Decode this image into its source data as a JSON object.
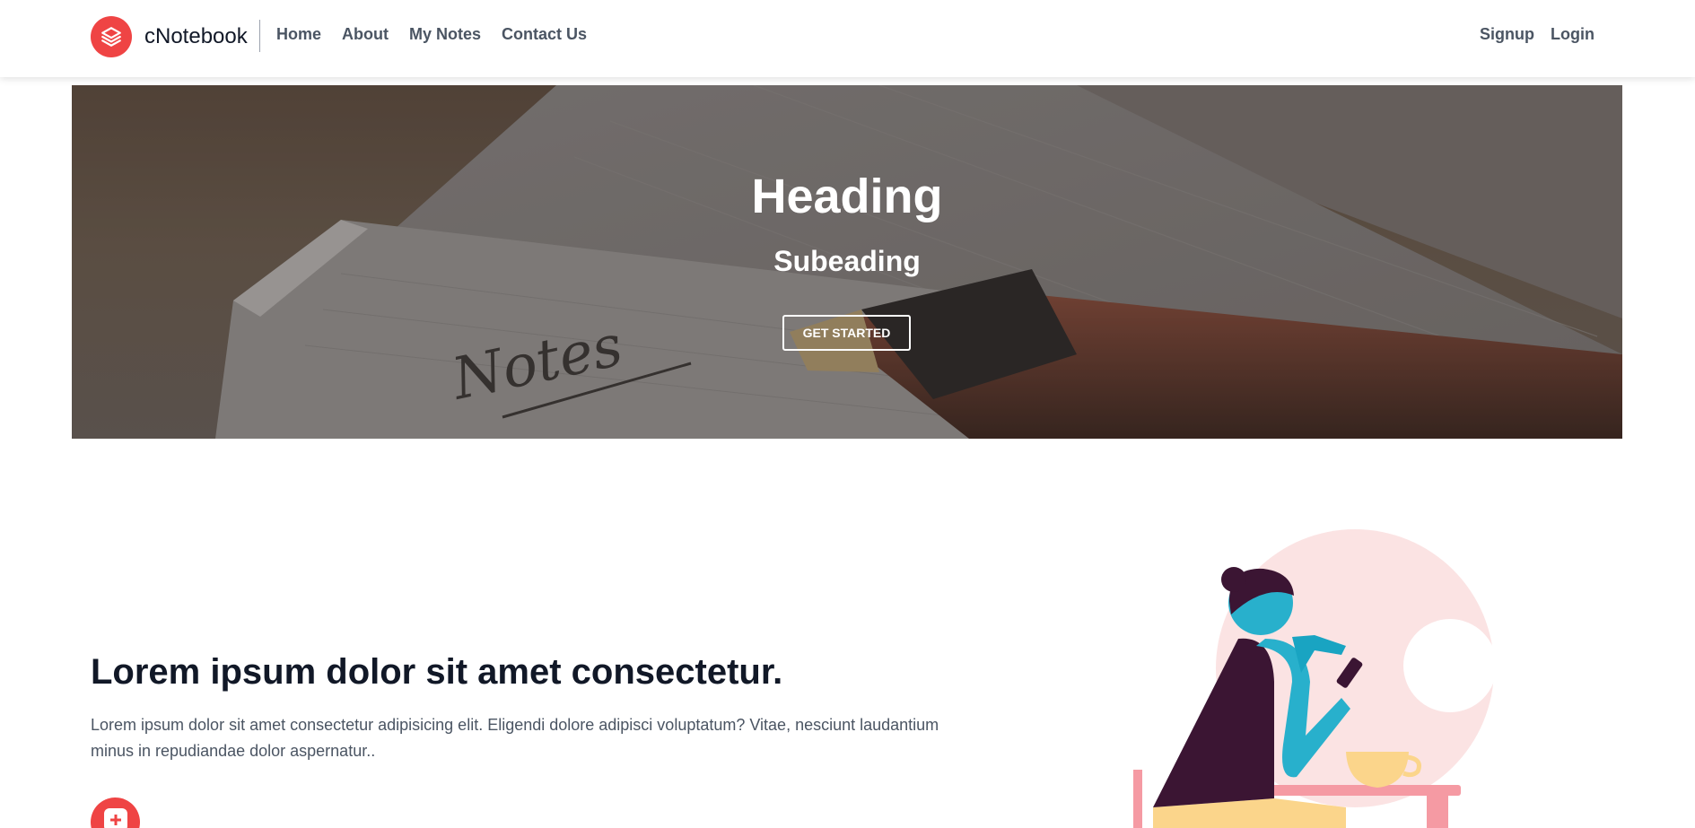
{
  "navbar": {
    "brand_name": "cNotebook",
    "brand_icon": "stack-layers-icon",
    "links": [
      "Home",
      "About",
      "My Notes",
      "Contact Us"
    ],
    "auth": {
      "signup": "Signup",
      "login": "Login"
    }
  },
  "hero": {
    "heading": "Heading",
    "subheading": "Subeading",
    "cta_label": "GET STARTED",
    "background_handwriting": "Notes"
  },
  "feature": {
    "title": "Lorem ipsum dolor sit amet consectetur.",
    "text": "Lorem ipsum dolor sit amet consectetur adipisicing elit. Eligendi dolore adipisci voluptatum? Vitae, nesciunt laudantium minus in repudiandae dolor aspernatur..",
    "icon": "plus-square-icon"
  },
  "colors": {
    "accent": "#ef4444",
    "nav_text": "#4b5563",
    "heading_text": "#111827"
  }
}
